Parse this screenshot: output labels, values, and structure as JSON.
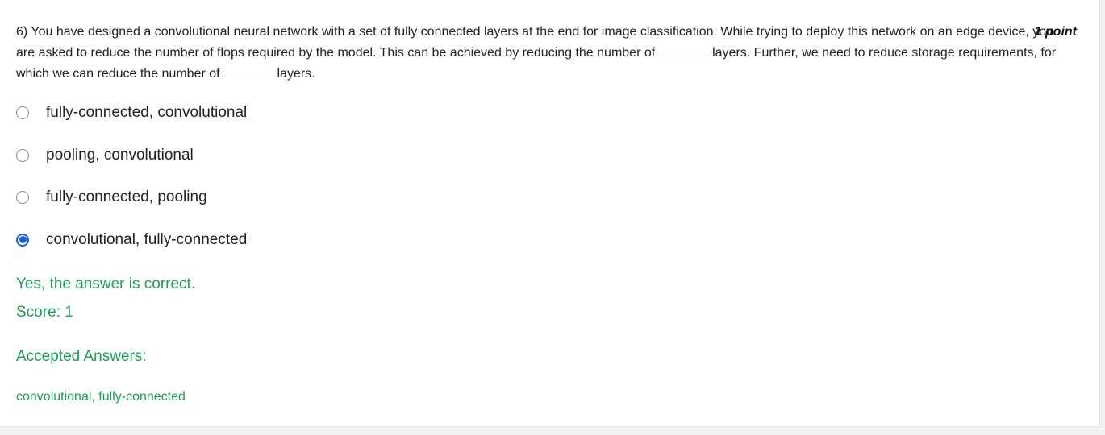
{
  "question": {
    "number": "6)",
    "text_part1": "You have designed a convolutional neural network with a set of fully connected layers at the end for image classification. While trying to deploy this network on an edge device, you are asked to reduce the number of flops required by the model. This can be achieved by reducing the number of",
    "text_part2": "layers. Further, we need to reduce storage requirements, for which we can reduce the number of",
    "text_part3": "layers.",
    "points": "1 point"
  },
  "options": [
    {
      "label": "fully-connected, convolutional",
      "selected": false
    },
    {
      "label": "pooling, convolutional",
      "selected": false
    },
    {
      "label": "fully-connected, pooling",
      "selected": false
    },
    {
      "label": "convolutional, fully-connected",
      "selected": true
    }
  ],
  "feedback": {
    "message": "Yes, the answer is correct.",
    "score": "Score: 1",
    "accepted_title": "Accepted Answers:",
    "accepted_answer": "convolutional, fully-connected"
  },
  "colors": {
    "accent": "#1a5fd6",
    "success": "#1f9d55"
  }
}
